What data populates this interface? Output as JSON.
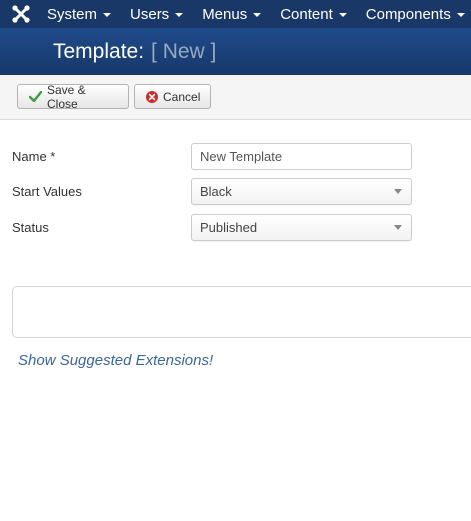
{
  "nav": {
    "items": [
      {
        "label": "System"
      },
      {
        "label": "Users"
      },
      {
        "label": "Menus"
      },
      {
        "label": "Content"
      },
      {
        "label": "Components"
      }
    ]
  },
  "header": {
    "title": "Template:",
    "subtitle": "[ New ]"
  },
  "toolbar": {
    "save_close_label": "Save & Close",
    "cancel_label": "Cancel"
  },
  "form": {
    "name": {
      "label": "Name *",
      "value": "New Template"
    },
    "start_values": {
      "label": "Start Values",
      "value": "Black"
    },
    "status": {
      "label": "Status",
      "value": "Published"
    }
  },
  "links": {
    "suggested_extensions": "Show Suggested Extensions!"
  },
  "colors": {
    "nav_bg": "#1a3867",
    "title_bg": "#1f4b8a",
    "save_icon": "#3c9d3c",
    "cancel_icon": "#c9302c",
    "link": "#3b66a0"
  }
}
